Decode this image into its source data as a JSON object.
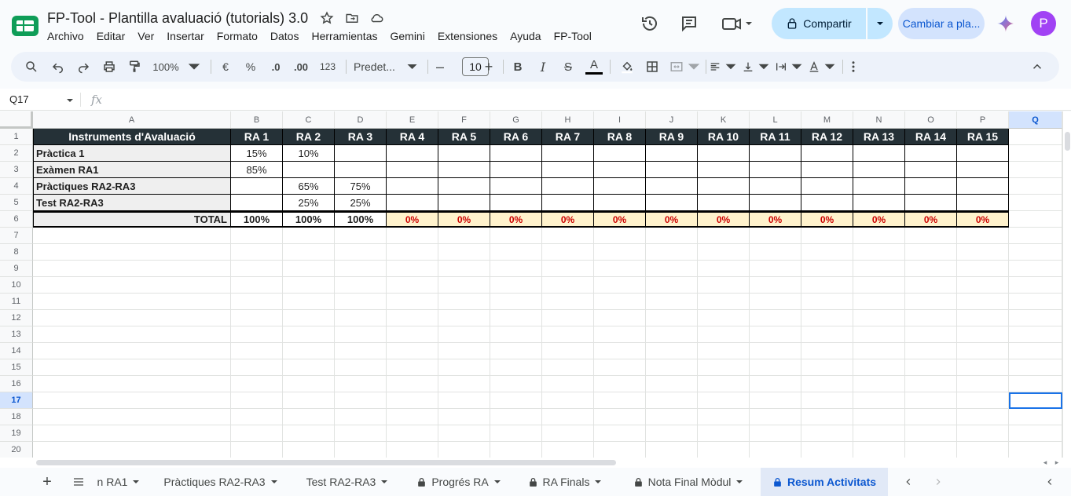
{
  "app": {
    "doc_title": "FP-Tool - Plantilla avaluació (tutorials) 3.0",
    "menu": [
      "Archivo",
      "Editar",
      "Ver",
      "Insertar",
      "Formato",
      "Datos",
      "Herramientas",
      "Gemini",
      "Extensiones",
      "Ayuda",
      "FP-Tool"
    ],
    "share_label": "Compartir",
    "plan_label": "Cambiar a pla...",
    "avatar_letter": "P",
    "colors": {
      "accent": "#0b57d0",
      "share_bg": "#c2e7ff",
      "header_fill": "#253137",
      "total_fill": "#fff2cc",
      "alert_red": "#cc0000",
      "avatar": "#a142f4",
      "sheets_green": "#0f9d58"
    }
  },
  "toolbar": {
    "zoom": "100%",
    "currency": "€",
    "percent": "%",
    "dec_less": ".0",
    "dec_more": ".00",
    "number_format": "123",
    "font_name": "Predet...",
    "font_size": "10",
    "bold": "B",
    "italic": "I",
    "strike": "S",
    "text_color": "A"
  },
  "formula_bar": {
    "name_box": "Q17",
    "fx": "fx",
    "value": ""
  },
  "sheet": {
    "columns": [
      "A",
      "B",
      "C",
      "D",
      "E",
      "F",
      "G",
      "H",
      "I",
      "J",
      "K",
      "L",
      "M",
      "N",
      "O",
      "P",
      "Q"
    ],
    "row_numbers": [
      "1",
      "2",
      "3",
      "4",
      "5",
      "6",
      "7",
      "8",
      "9",
      "10",
      "11",
      "12",
      "13",
      "14",
      "15",
      "16",
      "17",
      "18",
      "19",
      "20"
    ],
    "selected_cell": "Q17",
    "rows": [
      [
        "Instruments d'Avaluació",
        "RA 1",
        "RA 2",
        "RA 3",
        "RA 4",
        "RA 5",
        "RA 6",
        "RA 7",
        "RA 8",
        "RA 9",
        "RA 10",
        "RA 11",
        "RA 12",
        "RA 13",
        "RA 14",
        "RA 15"
      ],
      [
        "Pràctica 1",
        "15%",
        "10%",
        "",
        "",
        "",
        "",
        "",
        "",
        "",
        "",
        "",
        "",
        "",
        "",
        ""
      ],
      [
        "Exàmen RA1",
        "85%",
        "",
        "",
        "",
        "",
        "",
        "",
        "",
        "",
        "",
        "",
        "",
        "",
        "",
        ""
      ],
      [
        "Pràctiques RA2-RA3",
        "",
        "65%",
        "75%",
        "",
        "",
        "",
        "",
        "",
        "",
        "",
        "",
        "",
        "",
        "",
        ""
      ],
      [
        "Test RA2-RA3",
        "",
        "25%",
        "25%",
        "",
        "",
        "",
        "",
        "",
        "",
        "",
        "",
        "",
        "",
        "",
        ""
      ],
      [
        "TOTAL",
        "100%",
        "100%",
        "100%",
        "0%",
        "0%",
        "0%",
        "0%",
        "0%",
        "0%",
        "0%",
        "0%",
        "0%",
        "0%",
        "0%",
        "0%"
      ]
    ]
  },
  "tabs": {
    "items": [
      {
        "label": "n RA1",
        "locked": false
      },
      {
        "label": "Pràctiques RA2-RA3",
        "locked": false
      },
      {
        "label": "Test RA2-RA3",
        "locked": false
      },
      {
        "label": "Progrés RA",
        "locked": true
      },
      {
        "label": "RA Finals",
        "locked": true
      },
      {
        "label": "Nota Final Mòdul",
        "locked": true
      },
      {
        "label": "Resum Activitats",
        "locked": true,
        "active": true
      }
    ]
  }
}
